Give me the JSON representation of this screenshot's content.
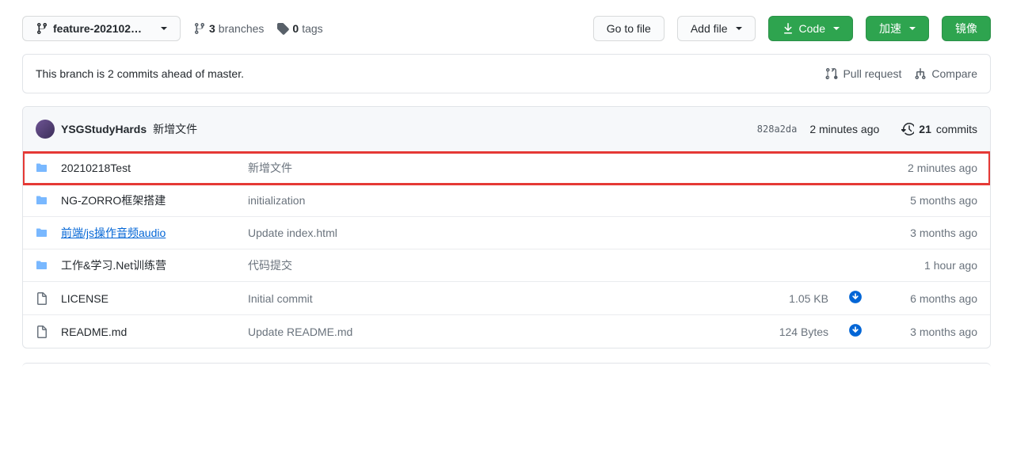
{
  "toolbar": {
    "branch_name": "feature-202102…",
    "branches_count": "3",
    "branches_label": "branches",
    "tags_count": "0",
    "tags_label": "tags",
    "go_to_file": "Go to file",
    "add_file": "Add file",
    "code": "Code",
    "accelerate": "加速",
    "mirror": "镜像"
  },
  "branch_info": {
    "text": "This branch is 2 commits ahead of master.",
    "pull_request": "Pull request",
    "compare": "Compare"
  },
  "commit_header": {
    "author": "YSGStudyHards",
    "message": "新增文件",
    "sha": "828a2da",
    "time": "2 minutes ago",
    "commits_count": "21",
    "commits_label": "commits"
  },
  "files": [
    {
      "type": "dir",
      "name": "20210218Test",
      "msg": "新增文件",
      "size": "",
      "download": false,
      "time": "2 minutes ago",
      "hovered": false,
      "highlighted": true
    },
    {
      "type": "dir",
      "name": "NG-ZORRO框架搭建",
      "msg": "initialization",
      "size": "",
      "download": false,
      "time": "5 months ago",
      "hovered": false,
      "highlighted": false
    },
    {
      "type": "dir",
      "name": "前端/js操作音频audio",
      "msg": "Update index.html",
      "size": "",
      "download": false,
      "time": "3 months ago",
      "hovered": true,
      "highlighted": false
    },
    {
      "type": "dir",
      "name": "工作&学习.Net训练营",
      "msg": "代码提交",
      "size": "",
      "download": false,
      "time": "1 hour ago",
      "hovered": false,
      "highlighted": false
    },
    {
      "type": "file",
      "name": "LICENSE",
      "msg": "Initial commit",
      "size": "1.05 KB",
      "download": true,
      "time": "6 months ago",
      "hovered": false,
      "highlighted": false
    },
    {
      "type": "file",
      "name": "README.md",
      "msg": "Update README.md",
      "size": "124 Bytes",
      "download": true,
      "time": "3 months ago",
      "hovered": false,
      "highlighted": false
    }
  ]
}
